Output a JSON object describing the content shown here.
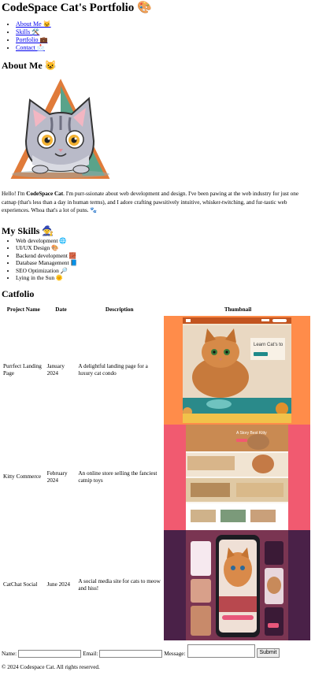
{
  "site": {
    "title": "CodeSpace Cat's Portfolio 🎨"
  },
  "nav": {
    "items": [
      "About Me 🐱",
      "Skills 🛠️",
      "Portfolio 💼",
      "Contact 📩"
    ]
  },
  "about": {
    "heading": "About Me 😺",
    "text_intro": "Hello! I'm ",
    "name": "CodeSpace Cat",
    "text_body": ". I'm purr-ssionate about web development and design. I've been pawing at the web industry for just one catnap (that's less than a day in human terms), and I adore crafting pawsitively intuitive, whisker-twitching, and fur-tastic web experiences. Whoa that's a lot of puns. 🐾"
  },
  "skills": {
    "heading": "My Skills 🧙",
    "items": [
      "Web development 🌐",
      "UI/UX Design 🎨",
      "Backend development 🧱",
      "Database Management 📘",
      "SEO Optimization 🔎",
      "Lying in the Sun 🌞"
    ]
  },
  "catfolio": {
    "heading": "Catfolio",
    "columns": [
      "Project Name",
      "Date",
      "Description",
      "Thumbnail"
    ],
    "rows": [
      {
        "name": "Purrfect Landing Page",
        "date": "January 2024",
        "description": "A delightful landing page for a luxury cat condo",
        "thumb_text": "Learn Cat’s to"
      },
      {
        "name": "Kitty Commerce",
        "date": "February 2024",
        "description": "An online store selling the fanciest catnip toys",
        "thumb_text": "A Story Best Kitty"
      },
      {
        "name": "CatChat Social",
        "date": "June 2024",
        "description": "A social media site for cats to meow and hiss!",
        "thumb_text": ""
      }
    ]
  },
  "contact": {
    "name_label": "Name:",
    "email_label": "Email:",
    "message_label": "Message:",
    "submit_label": "Submit"
  },
  "footer": {
    "text": "© 2024 Codespace Cat. All rights reserved."
  },
  "colors": {
    "link": "#0000ee",
    "thumb1_bg": "#ff8c4a",
    "thumb2_bg": "#f15a70",
    "thumb3_bg": "#4a2148"
  }
}
